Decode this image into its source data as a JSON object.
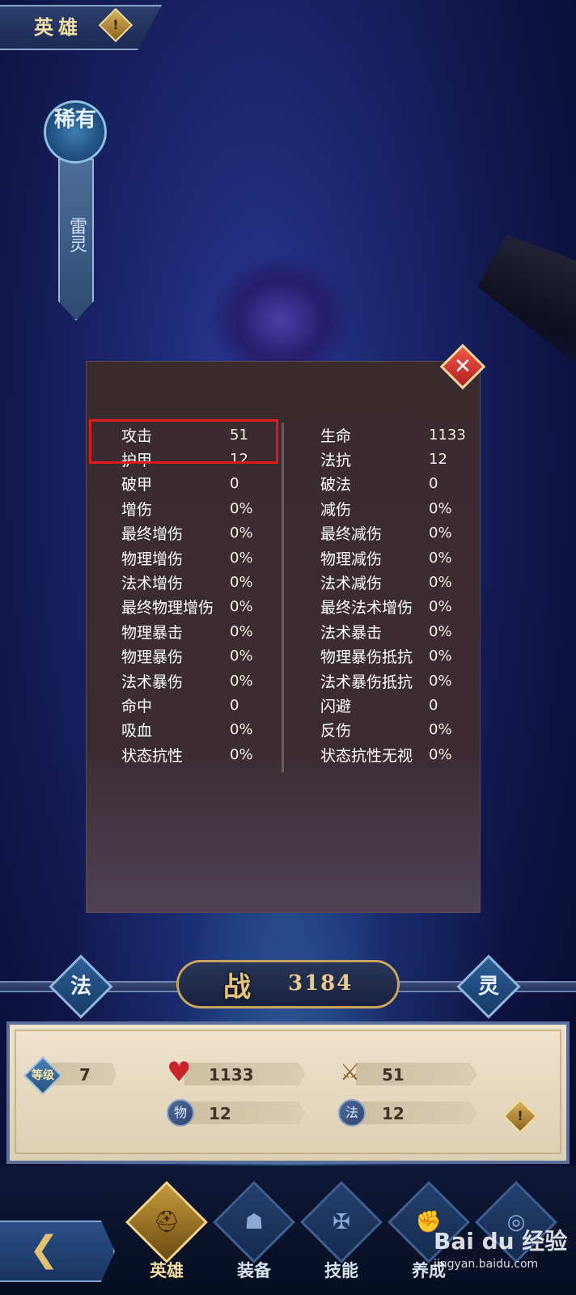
{
  "header": {
    "title": "英雄",
    "info_icon": "exclamation-icon"
  },
  "hero": {
    "rarity": "稀有",
    "element": "雷灵"
  },
  "stats_panel": {
    "close_icon": "close-icon",
    "left": [
      {
        "label": "攻击",
        "value": "51"
      },
      {
        "label": "护甲",
        "value": "12"
      },
      {
        "label": "破甲",
        "value": "0"
      },
      {
        "label": "增伤",
        "value": "0%"
      },
      {
        "label": "最终增伤",
        "value": "0%"
      },
      {
        "label": "物理增伤",
        "value": "0%"
      },
      {
        "label": "法术增伤",
        "value": "0%"
      },
      {
        "label": "最终物理增伤",
        "value": "0%"
      },
      {
        "label": "物理暴击",
        "value": "0%"
      },
      {
        "label": "物理暴伤",
        "value": "0%"
      },
      {
        "label": "法术暴伤",
        "value": "0%"
      },
      {
        "label": "命中",
        "value": "0"
      },
      {
        "label": "吸血",
        "value": "0%"
      },
      {
        "label": "状态抗性",
        "value": "0%"
      }
    ],
    "right": [
      {
        "label": "生命",
        "value": "1133"
      },
      {
        "label": "法抗",
        "value": "12"
      },
      {
        "label": "破法",
        "value": "0"
      },
      {
        "label": "减伤",
        "value": "0%"
      },
      {
        "label": "最终减伤",
        "value": "0%"
      },
      {
        "label": "物理减伤",
        "value": "0%"
      },
      {
        "label": "法术减伤",
        "value": "0%"
      },
      {
        "label": "最终法术增伤",
        "value": "0%"
      },
      {
        "label": "法术暴击",
        "value": "0%"
      },
      {
        "label": "物理暴伤抵抗",
        "value": "0%"
      },
      {
        "label": "法术暴伤抵抗",
        "value": "0%"
      },
      {
        "label": "闪避",
        "value": "0"
      },
      {
        "label": "反伤",
        "value": "0%"
      },
      {
        "label": "状态抗性无视",
        "value": "0%"
      }
    ],
    "highlight_color": "#e01a1a"
  },
  "power": {
    "icon_label": "战",
    "value": "3184",
    "left_button": "法",
    "right_button": "灵"
  },
  "info": {
    "level_label": "等级",
    "level_value": "7",
    "hp_value": "1133",
    "attack_value": "51",
    "armor_icon_label": "物",
    "armor_value": "12",
    "magic_resist_icon_label": "法",
    "magic_resist_value": "12",
    "info_icon": "exclamation-icon"
  },
  "nav": {
    "back_icon": "back-arrow-icon",
    "items": [
      {
        "label": "英雄",
        "icon": "helmet-icon",
        "active": true
      },
      {
        "label": "装备",
        "icon": "mask-icon",
        "active": false
      },
      {
        "label": "技能",
        "icon": "emblem-icon",
        "active": false
      },
      {
        "label": "养成",
        "icon": "fist-icon",
        "active": false
      },
      {
        "label": "",
        "icon": "swirl-icon",
        "active": false
      }
    ]
  },
  "watermark": {
    "brand": "Bai du 经验",
    "url": "jingyan.baidu.com"
  },
  "colors": {
    "gold": "#e9c98a",
    "panel_bg": "#3a2c31",
    "highlight": "#e01a1a"
  }
}
